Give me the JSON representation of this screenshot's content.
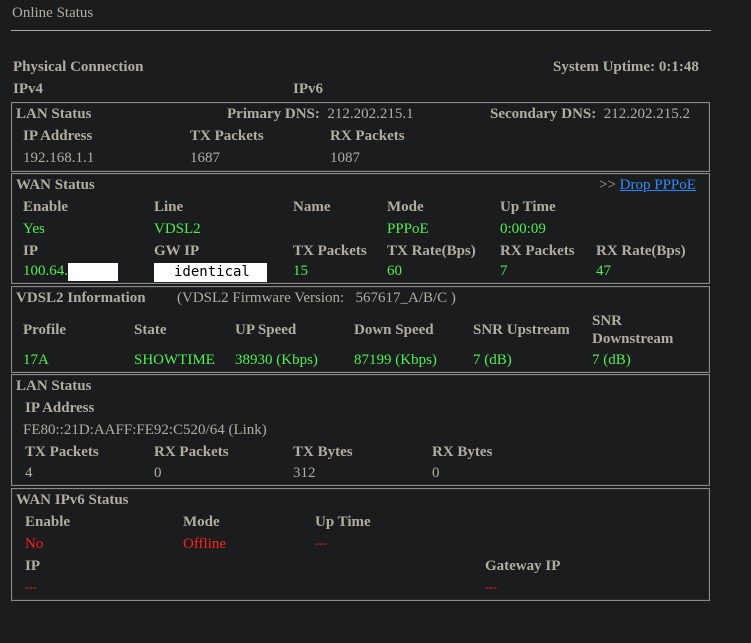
{
  "page": {
    "title": "Online Status"
  },
  "physical": {
    "heading": "Physical Connection",
    "uptime_label": "System Uptime:",
    "uptime_value": "0:1:48",
    "ipv4": "IPv4",
    "ipv6": "IPv6"
  },
  "lan": {
    "heading": "LAN Status",
    "primary_dns_label": "Primary DNS:",
    "primary_dns": "212.202.215.1",
    "secondary_dns_label": "Secondary DNS:",
    "secondary_dns": "212.202.215.2",
    "headers": [
      "IP Address",
      "TX Packets",
      "RX Packets"
    ],
    "values": [
      "192.168.1.1",
      "1687",
      "1087"
    ]
  },
  "wan": {
    "heading": "WAN Status",
    "drop_prefix": ">>",
    "drop_link": "Drop PPPoE",
    "headers1": [
      "Enable",
      "Line",
      "Name",
      "Mode",
      "Up Time"
    ],
    "values1": [
      "Yes",
      "VDSL2",
      "",
      "PPPoE",
      "0:00:09"
    ],
    "headers2": [
      "IP",
      "GW IP",
      "TX Packets",
      "TX Rate(Bps)",
      "RX Packets",
      "RX Rate(Bps)"
    ],
    "values2": [
      "100.64.",
      "identical",
      "15",
      "60",
      "7",
      "47"
    ]
  },
  "vdsl": {
    "heading": "VDSL2 Information",
    "firmware_label": "(VDSL2 Firmware Version:",
    "firmware": "567617_A/B/C )",
    "headers": [
      "Profile",
      "State",
      "UP Speed",
      "Down Speed",
      "SNR Upstream",
      "SNR Downstream"
    ],
    "values": [
      "17A",
      "SHOWTIME",
      "38930 (Kbps)",
      "87199 (Kbps)",
      "7 (dB)",
      "7 (dB)"
    ]
  },
  "lan6": {
    "heading": "LAN Status",
    "ip_label": "IP Address",
    "ip": "FE80::21D:AAFF:FE92:C520/64 (Link)",
    "headers": [
      "TX Packets",
      "RX Packets",
      "TX Bytes",
      "RX Bytes"
    ],
    "values": [
      "4",
      "0",
      "312",
      "0"
    ]
  },
  "wan6": {
    "heading": "WAN IPv6 Status",
    "headers": [
      "Enable",
      "Mode",
      "Up Time"
    ],
    "values": [
      "No",
      "Offline",
      "---"
    ],
    "ip_label": "IP",
    "ip": "---",
    "gw_label": "Gateway IP",
    "gw": "---"
  },
  "colors": {
    "background": "#1b1c1e",
    "text": "#b3ada0",
    "ok": "#50f050",
    "error": "#ff2020",
    "link": "#2f8cff"
  }
}
